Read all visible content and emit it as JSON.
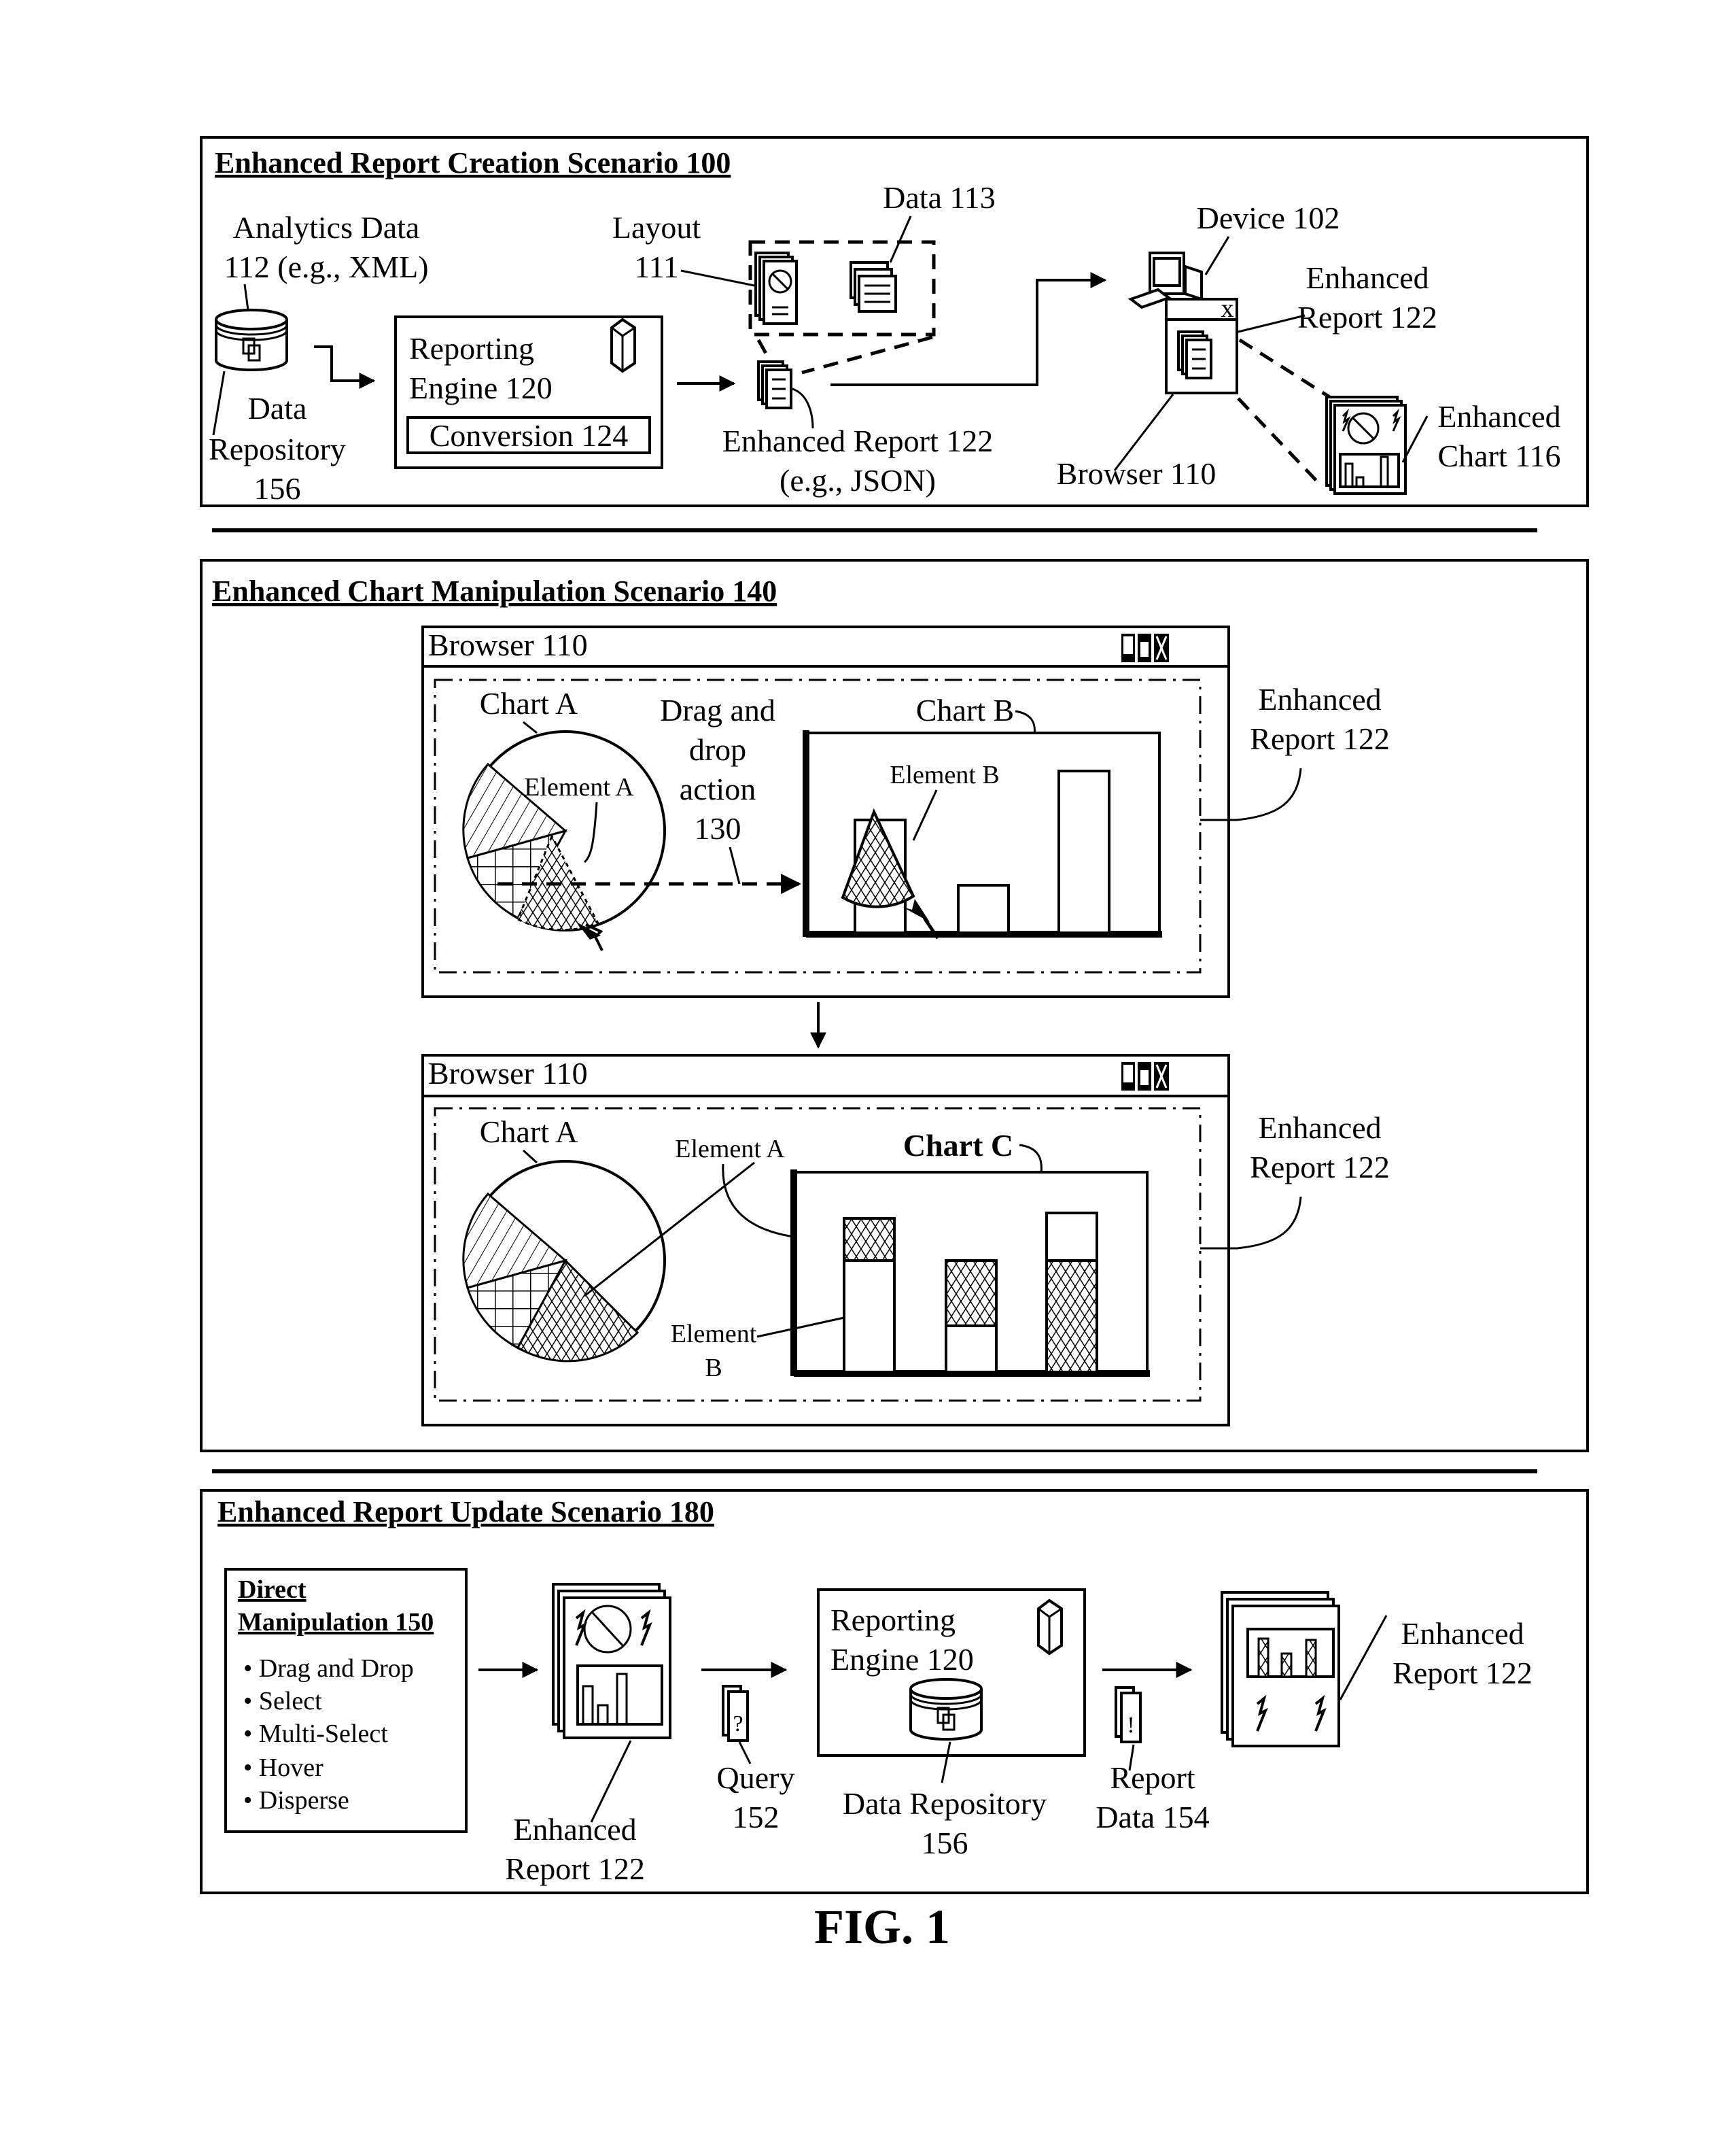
{
  "figure_label": "FIG. 1",
  "scenario_100": {
    "title": "Enhanced Report Creation Scenario 100",
    "analytics_data": [
      "Analytics Data",
      "112 (e.g., XML)"
    ],
    "data_repository": [
      "Data",
      "Repository",
      "156"
    ],
    "reporting_engine": [
      "Reporting",
      "Engine 120"
    ],
    "conversion": "Conversion 124",
    "layout": [
      "Layout",
      "111"
    ],
    "data_113": "Data 113",
    "enhanced_report_json": [
      "Enhanced Report 122",
      "(e.g., JSON)"
    ],
    "device": "Device 102",
    "enhanced_report": [
      "Enhanced",
      "Report 122"
    ],
    "browser": "Browser 110",
    "enhanced_chart": [
      "Enhanced",
      "Chart 116"
    ],
    "window_close_glyph": "_ x"
  },
  "scenario_140": {
    "title": "Enhanced Chart Manipulation Scenario 140",
    "browser_top": {
      "title": "Browser 110",
      "chart_a": "Chart A",
      "element_a": "Element A",
      "drag_label": [
        "Drag and",
        "drop",
        "action",
        "130"
      ],
      "chart_b": "Chart B",
      "element_b": "Element B",
      "report_label": [
        "Enhanced",
        "Report 122"
      ]
    },
    "browser_bottom": {
      "title": "Browser 110",
      "chart_a": "Chart A",
      "element_a": "Element A",
      "chart_c": "Chart C",
      "element_b": [
        "Element",
        "B"
      ],
      "report_label": [
        "Enhanced",
        "Report 122"
      ]
    }
  },
  "scenario_180": {
    "title": "Enhanced Report Update Scenario 180",
    "direct_manipulation": {
      "heading": [
        "Direct",
        "Manipulation 150"
      ],
      "items": [
        "• Drag and Drop",
        "• Select",
        "• Multi-Select",
        "• Hover",
        "• Disperse"
      ]
    },
    "enhanced_report_left": [
      "Enhanced",
      "Report 122"
    ],
    "query": [
      "Query",
      "152"
    ],
    "query_glyph": "?",
    "reporting_engine": [
      "Reporting",
      "Engine 120"
    ],
    "data_repository": [
      "Data Repository",
      "156"
    ],
    "report_data": [
      "Report",
      "Data 154"
    ],
    "report_data_glyph": "!",
    "enhanced_report_right": [
      "Enhanced",
      "Report 122"
    ]
  }
}
